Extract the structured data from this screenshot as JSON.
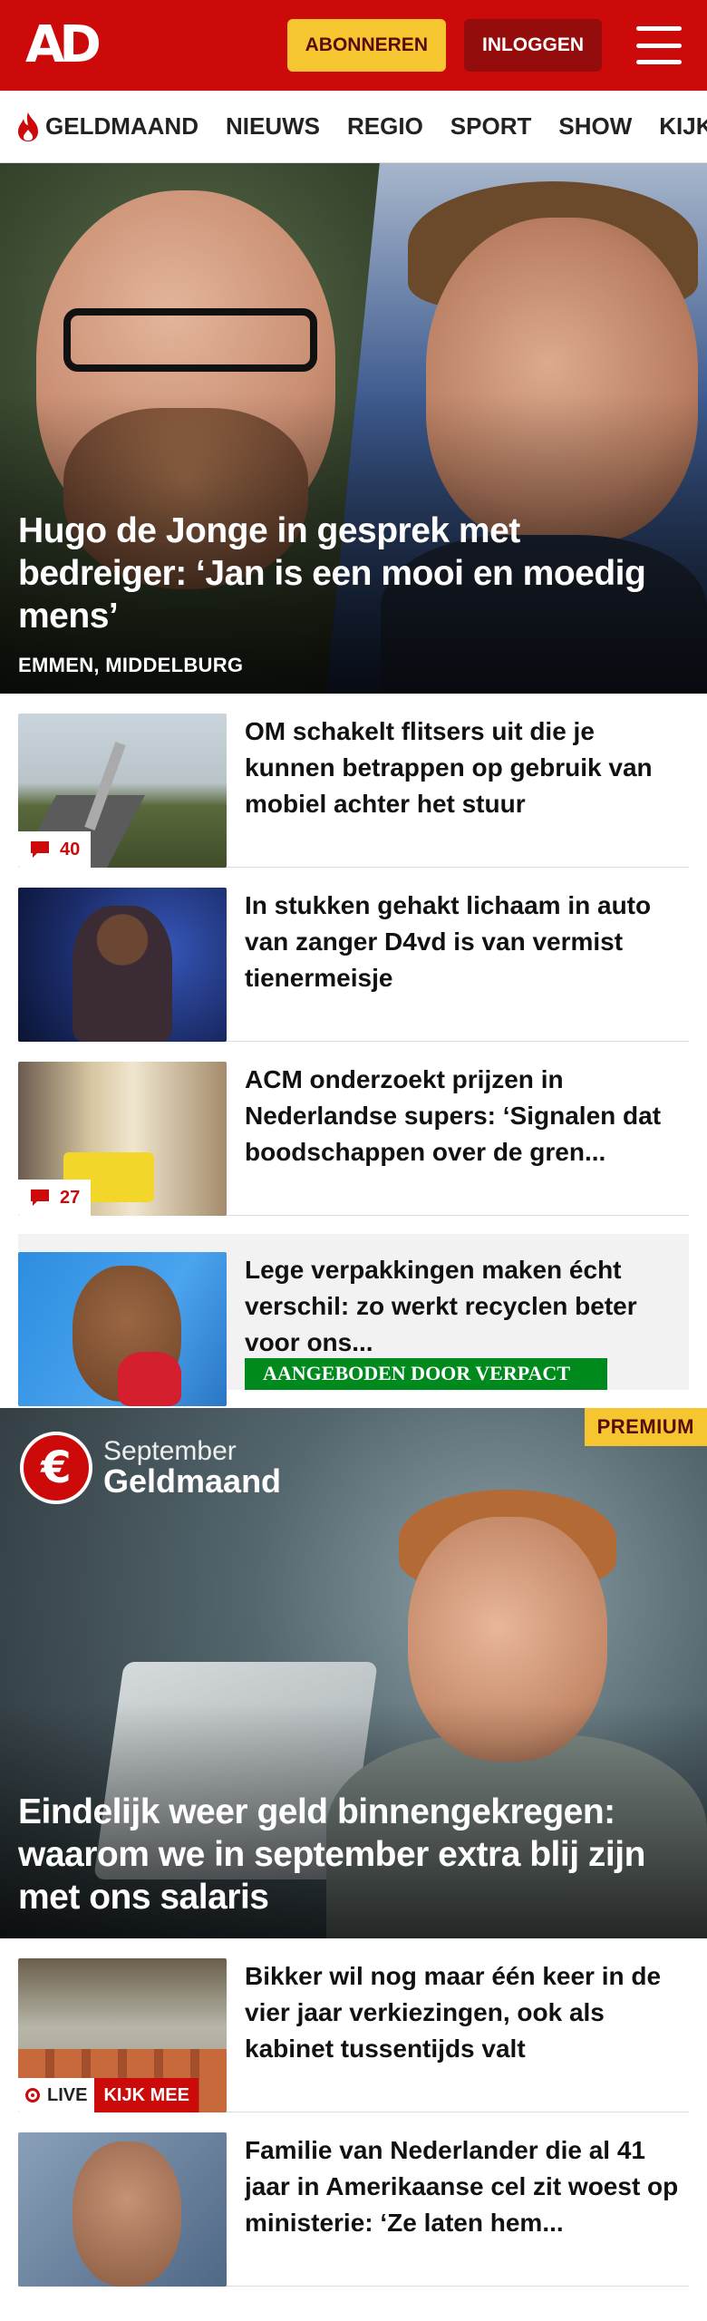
{
  "header": {
    "logo": "AD",
    "subscribe_label": "ABONNEREN",
    "login_label": "INLOGGEN"
  },
  "nav": {
    "items": [
      "GELDMAAND",
      "NIEUWS",
      "REGIO",
      "SPORT",
      "SHOW",
      "KIJK"
    ]
  },
  "hero": {
    "title": "Hugo de Jonge in gesprek met bedreiger: ‘Jan is een mooi en moedig mens’",
    "location": "EMMEN, MIDDELBURG"
  },
  "articles": [
    {
      "title": "OM schakelt flitsers uit die je kunnen betrappen op gebruik van mobiel achter het stuur",
      "comments": "40"
    },
    {
      "title": "In stukken gehakt lichaam in auto van zanger D4vd is van vermist tienermeisje"
    },
    {
      "title": "ACM onderzoekt prijzen in Nederlandse supers: ‘Signalen dat boodschappen over de gren...",
      "comments": "27"
    }
  ],
  "sponsored": {
    "title": "Lege verpakkingen maken écht verschil: zo werkt recyclen beter voor ons...",
    "tag": "AANGEBODEN DOOR VERPACT"
  },
  "feature": {
    "badge": "PREMIUM",
    "brand_month": "September",
    "brand_name": "Geldmaand",
    "brand_symbol": "€",
    "title": "Eindelijk weer geld binnengekregen: waarom we in september extra blij zijn met ons salaris"
  },
  "more_articles": [
    {
      "title": "Bikker wil nog maar één keer in de vier jaar verkiezingen, ook als kabinet tussentijds valt",
      "live_label": "LIVE",
      "watch_label": "KIJK MEE"
    },
    {
      "title": "Familie van Nederlander die al 41 jaar in Amerikaanse cel zit woest op ministerie: ‘Ze laten hem..."
    }
  ],
  "colors": {
    "brand_red": "#cc0a0a",
    "subscribe_yellow": "#f6c630",
    "login_dark_red": "#950c0c",
    "sponsor_green": "#008a1e"
  },
  "icons": {
    "menu": "hamburger-icon",
    "flame": "flame-icon",
    "comment": "comment-icon",
    "live": "live-dot-icon"
  }
}
